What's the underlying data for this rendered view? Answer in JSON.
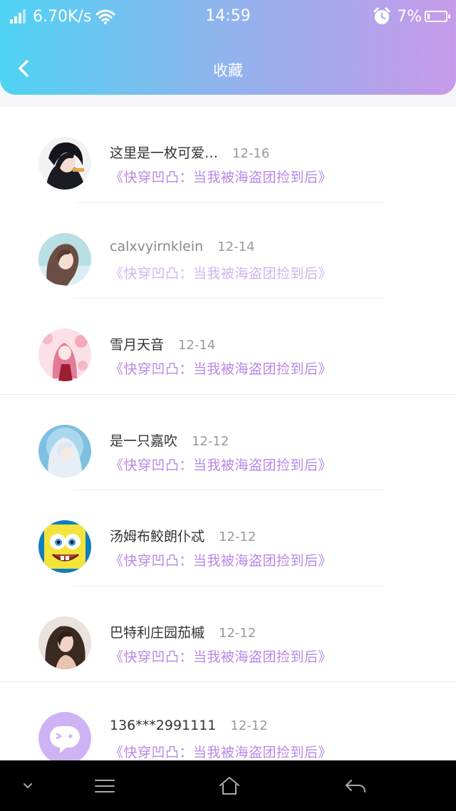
{
  "status_bar": {
    "speed": "6.70K/s",
    "time": "14:59",
    "battery": "7%",
    "battery_level": 0.07,
    "icons": [
      "signal-icon",
      "wifi-icon",
      "alarm-icon",
      "battery-icon"
    ]
  },
  "header": {
    "title": "收藏",
    "back_icon": "chevron-left-icon"
  },
  "favorites": [
    {
      "name": "这里是一枚可爱…",
      "date": "12-16",
      "book": "《快穿凹凸：当我被海盗团捡到后》"
    },
    {
      "name": "calxvyirnklein",
      "date": "12-14",
      "book": "《快穿凹凸：当我被海盗团捡到后》"
    },
    {
      "name": "雪月天音",
      "date": "12-14",
      "book": "《快穿凹凸：当我被海盗团捡到后》"
    },
    {
      "name": "是一只嘉吹",
      "date": "12-12",
      "book": "《快穿凹凸：当我被海盗团捡到后》"
    },
    {
      "name": "汤姆布鲛朗仆忒",
      "date": "12-12",
      "book": "《快穿凹凸：当我被海盗团捡到后》"
    },
    {
      "name": "巴特利庄园茄槭",
      "date": "12-12",
      "book": "《快穿凹凸：当我被海盗团捡到后》"
    },
    {
      "name": "136***2991111",
      "date": "12-12",
      "book": "《快穿凹凸：当我被海盗团捡到后》"
    }
  ],
  "colors": {
    "header_gradient": [
      "#4fd3f2",
      "#8fb4ee",
      "#c79aea"
    ],
    "book_title": "#b787e6",
    "system_bar": "#000000"
  },
  "system_nav": [
    "chevron-down-icon",
    "menu-icon",
    "home-icon",
    "back-arrow-icon"
  ]
}
